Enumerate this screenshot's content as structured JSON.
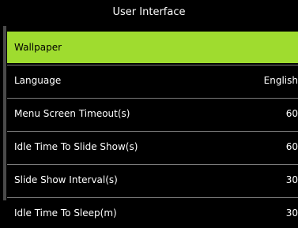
{
  "header": {
    "title": "User Interface"
  },
  "menu": {
    "items": [
      {
        "label": "Wallpaper",
        "value": ""
      },
      {
        "label": "Language",
        "value": "English"
      },
      {
        "label": "Menu Screen Timeout(s)",
        "value": "60"
      },
      {
        "label": "Idle Time To Slide Show(s)",
        "value": "60"
      },
      {
        "label": "Slide Show Interval(s)",
        "value": "30"
      },
      {
        "label": "Idle Time To Sleep(m)",
        "value": "30"
      }
    ],
    "selected_index": 0
  },
  "colors": {
    "background": "#000000",
    "text": "#ffffff",
    "selected_background": "#9fdc2f",
    "selected_text": "#000000",
    "divider": "#7a7a7a",
    "scrollbar": "#4a4a4a"
  }
}
